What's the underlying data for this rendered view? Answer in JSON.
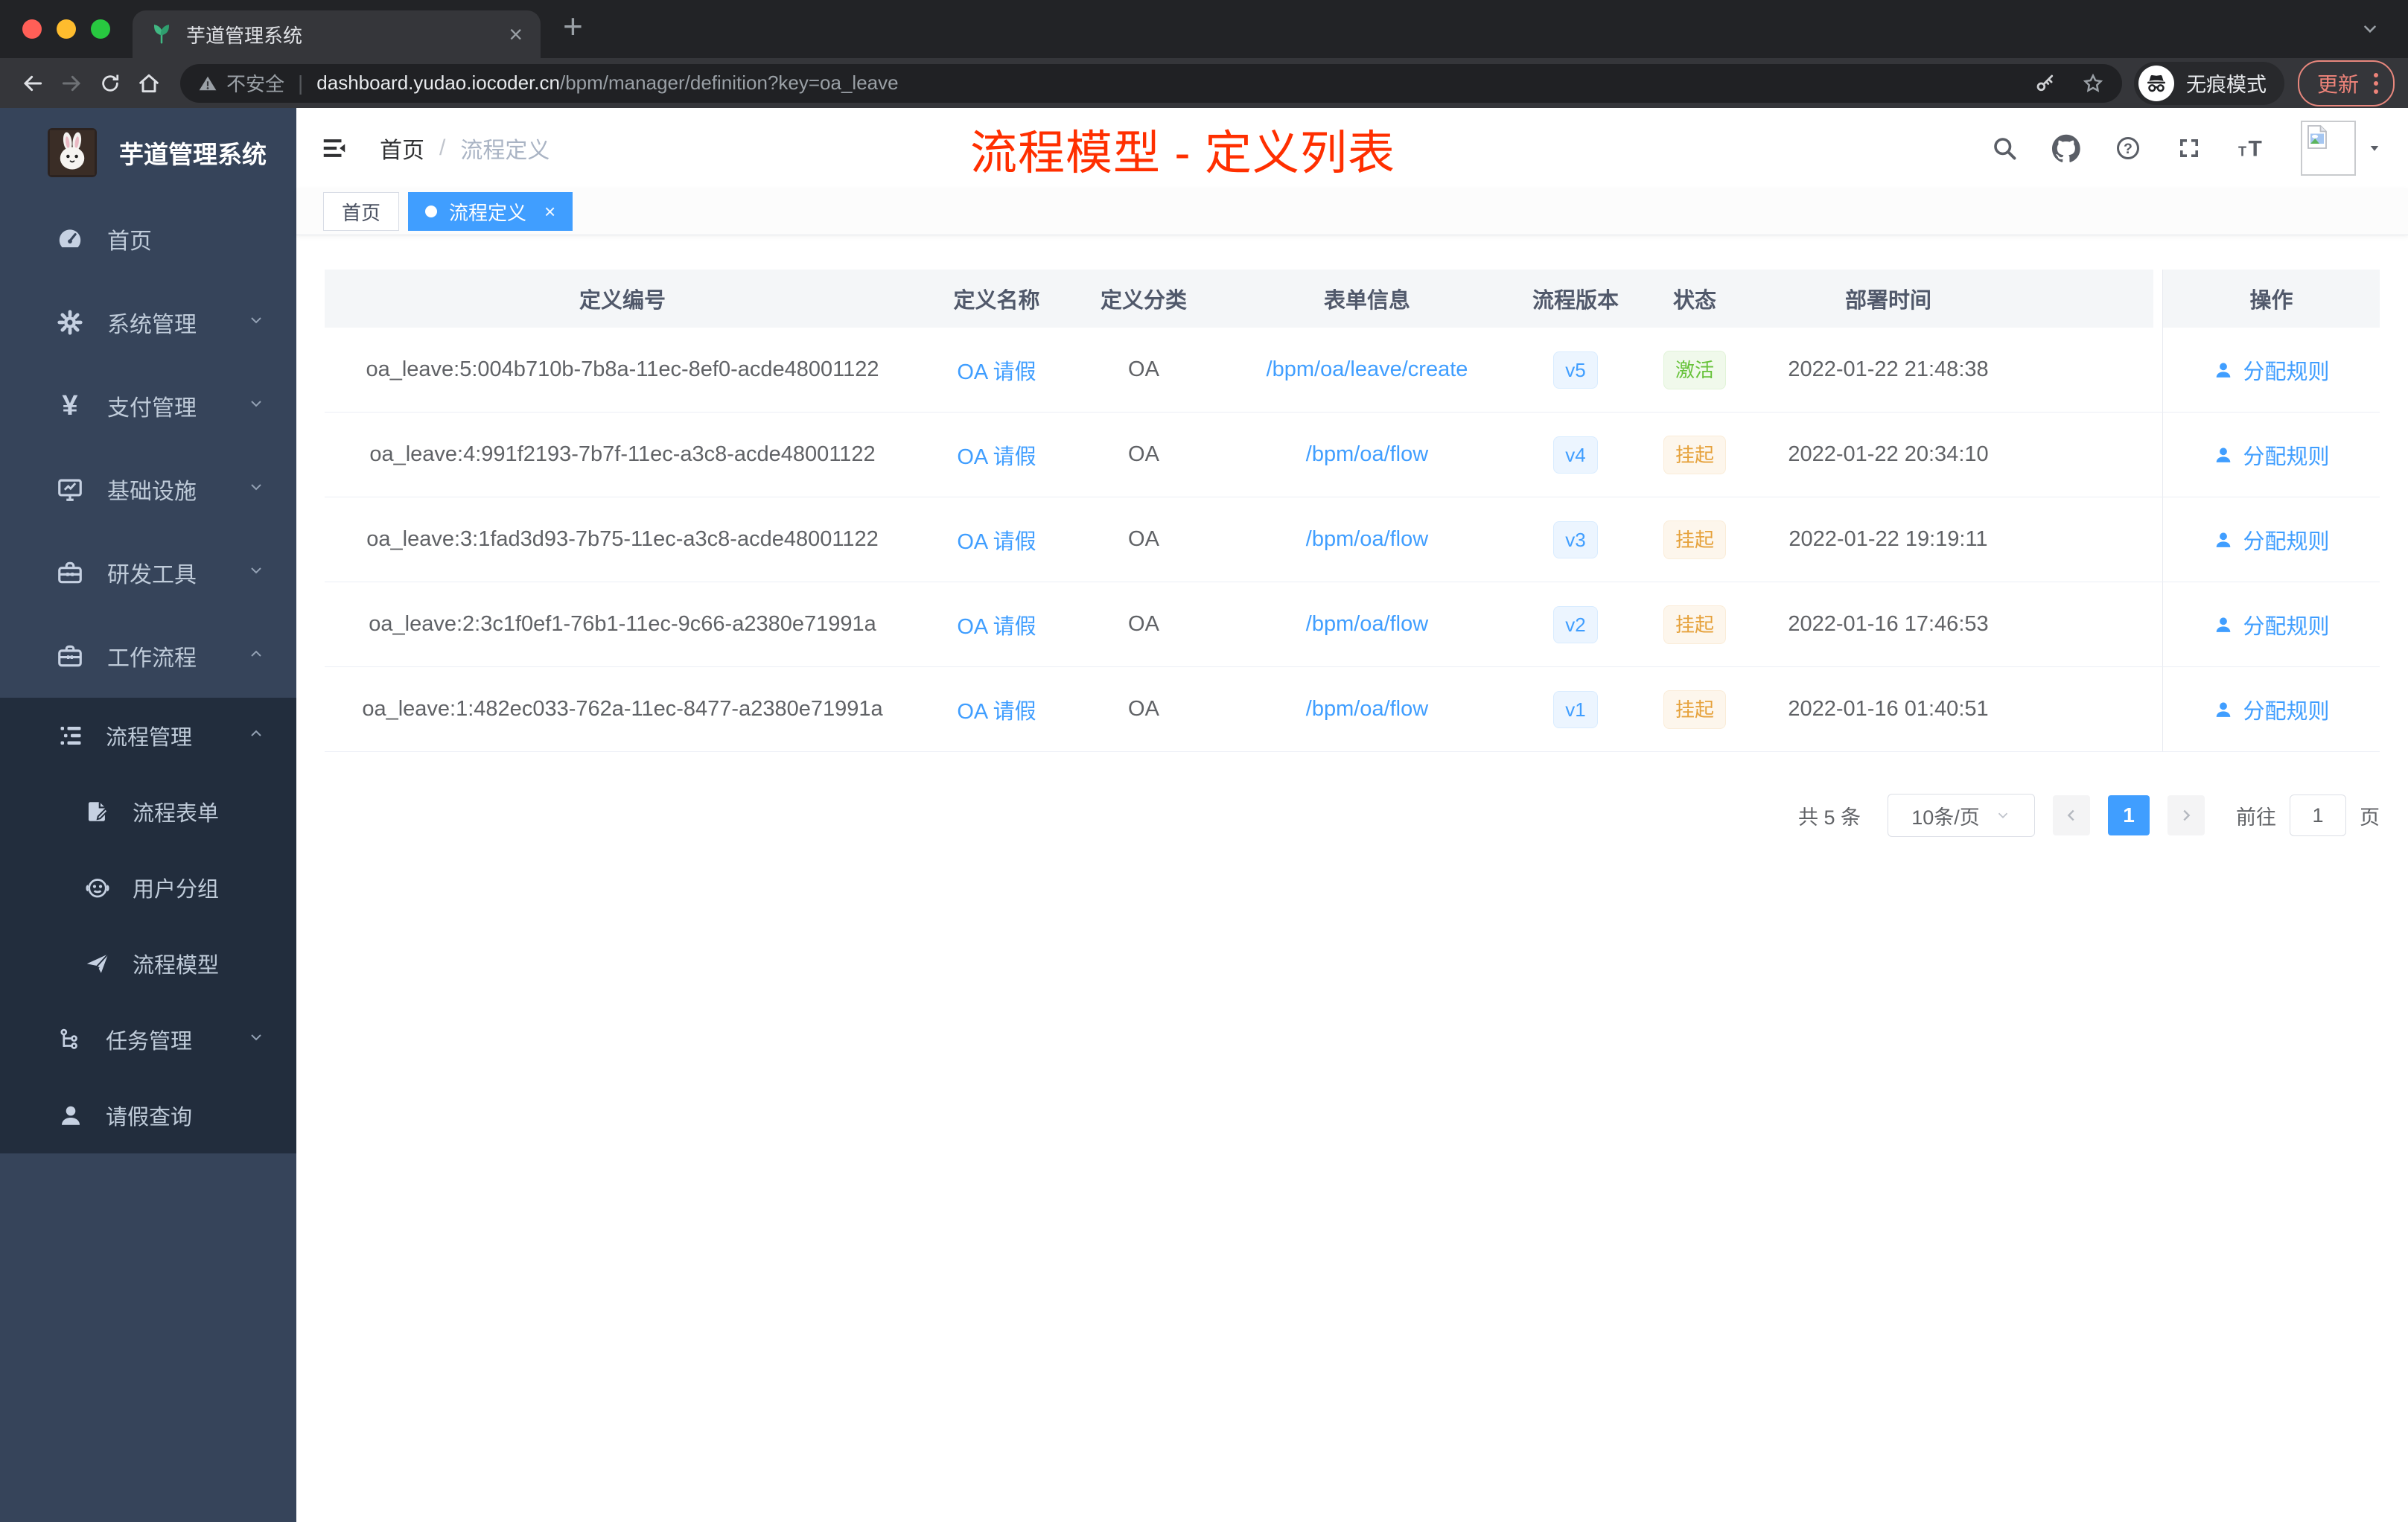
{
  "browser": {
    "tab_title": "芋道管理系统",
    "new_tab_label": "+",
    "close_tab_label": "×",
    "security_label": "不安全",
    "url_host": "dashboard.yudao.iocoder.cn",
    "url_path": "/bpm/manager/definition?key=oa_leave",
    "incognito_label": "无痕模式",
    "update_label": "更新"
  },
  "sidebar": {
    "logo_title": "芋道管理系统",
    "menu": [
      {
        "label": "首页"
      },
      {
        "label": "系统管理"
      },
      {
        "label": "支付管理"
      },
      {
        "label": "基础设施"
      },
      {
        "label": "研发工具"
      },
      {
        "label": "工作流程"
      }
    ],
    "submenu": [
      {
        "label": "流程管理"
      },
      {
        "label": "流程表单"
      },
      {
        "label": "用户分组"
      },
      {
        "label": "流程模型"
      },
      {
        "label": "任务管理"
      },
      {
        "label": "请假查询"
      }
    ]
  },
  "navbar": {
    "breadcrumb_home": "首页",
    "breadcrumb_sep": "/",
    "breadcrumb_current": "流程定义",
    "annotation_title": "流程模型 - 定义列表"
  },
  "tags": {
    "home": "首页",
    "active": "流程定义",
    "active_close": "×"
  },
  "table": {
    "columns": [
      "定义编号",
      "定义名称",
      "定义分类",
      "表单信息",
      "流程版本",
      "状态",
      "部署时间",
      "操作"
    ],
    "action_label": "分配规则",
    "rows": [
      {
        "id": "oa_leave:5:004b710b-7b8a-11ec-8ef0-acde48001122",
        "name": "OA 请假",
        "category": "OA",
        "form": "/bpm/oa/leave/create",
        "version": "v5",
        "status": "激活",
        "status_type": "active",
        "deploy_time": "2022-01-22 21:48:38"
      },
      {
        "id": "oa_leave:4:991f2193-7b7f-11ec-a3c8-acde48001122",
        "name": "OA 请假",
        "category": "OA",
        "form": "/bpm/oa/flow",
        "version": "v4",
        "status": "挂起",
        "status_type": "suspend",
        "deploy_time": "2022-01-22 20:34:10"
      },
      {
        "id": "oa_leave:3:1fad3d93-7b75-11ec-a3c8-acde48001122",
        "name": "OA 请假",
        "category": "OA",
        "form": "/bpm/oa/flow",
        "version": "v3",
        "status": "挂起",
        "status_type": "suspend",
        "deploy_time": "2022-01-22 19:19:11"
      },
      {
        "id": "oa_leave:2:3c1f0ef1-76b1-11ec-9c66-a2380e71991a",
        "name": "OA 请假",
        "category": "OA",
        "form": "/bpm/oa/flow",
        "version": "v2",
        "status": "挂起",
        "status_type": "suspend",
        "deploy_time": "2022-01-16 17:46:53"
      },
      {
        "id": "oa_leave:1:482ec033-762a-11ec-8477-a2380e71991a",
        "name": "OA 请假",
        "category": "OA",
        "form": "/bpm/oa/flow",
        "version": "v1",
        "status": "挂起",
        "status_type": "suspend",
        "deploy_time": "2022-01-16 01:40:51"
      }
    ]
  },
  "pagination": {
    "total": "共 5 条",
    "page_size": "10条/页",
    "prev": "‹",
    "page": "1",
    "next": "›",
    "goto_label": "前往",
    "goto_value": "1",
    "page_unit": "页"
  },
  "colors": {
    "accent_blue": "#409eff",
    "success_green": "#67c23a",
    "warning_orange": "#e6a23c",
    "annotation_red": "#ff2f00",
    "sidebar_bg": "#36445a",
    "submenu_bg": "#222d3d"
  }
}
